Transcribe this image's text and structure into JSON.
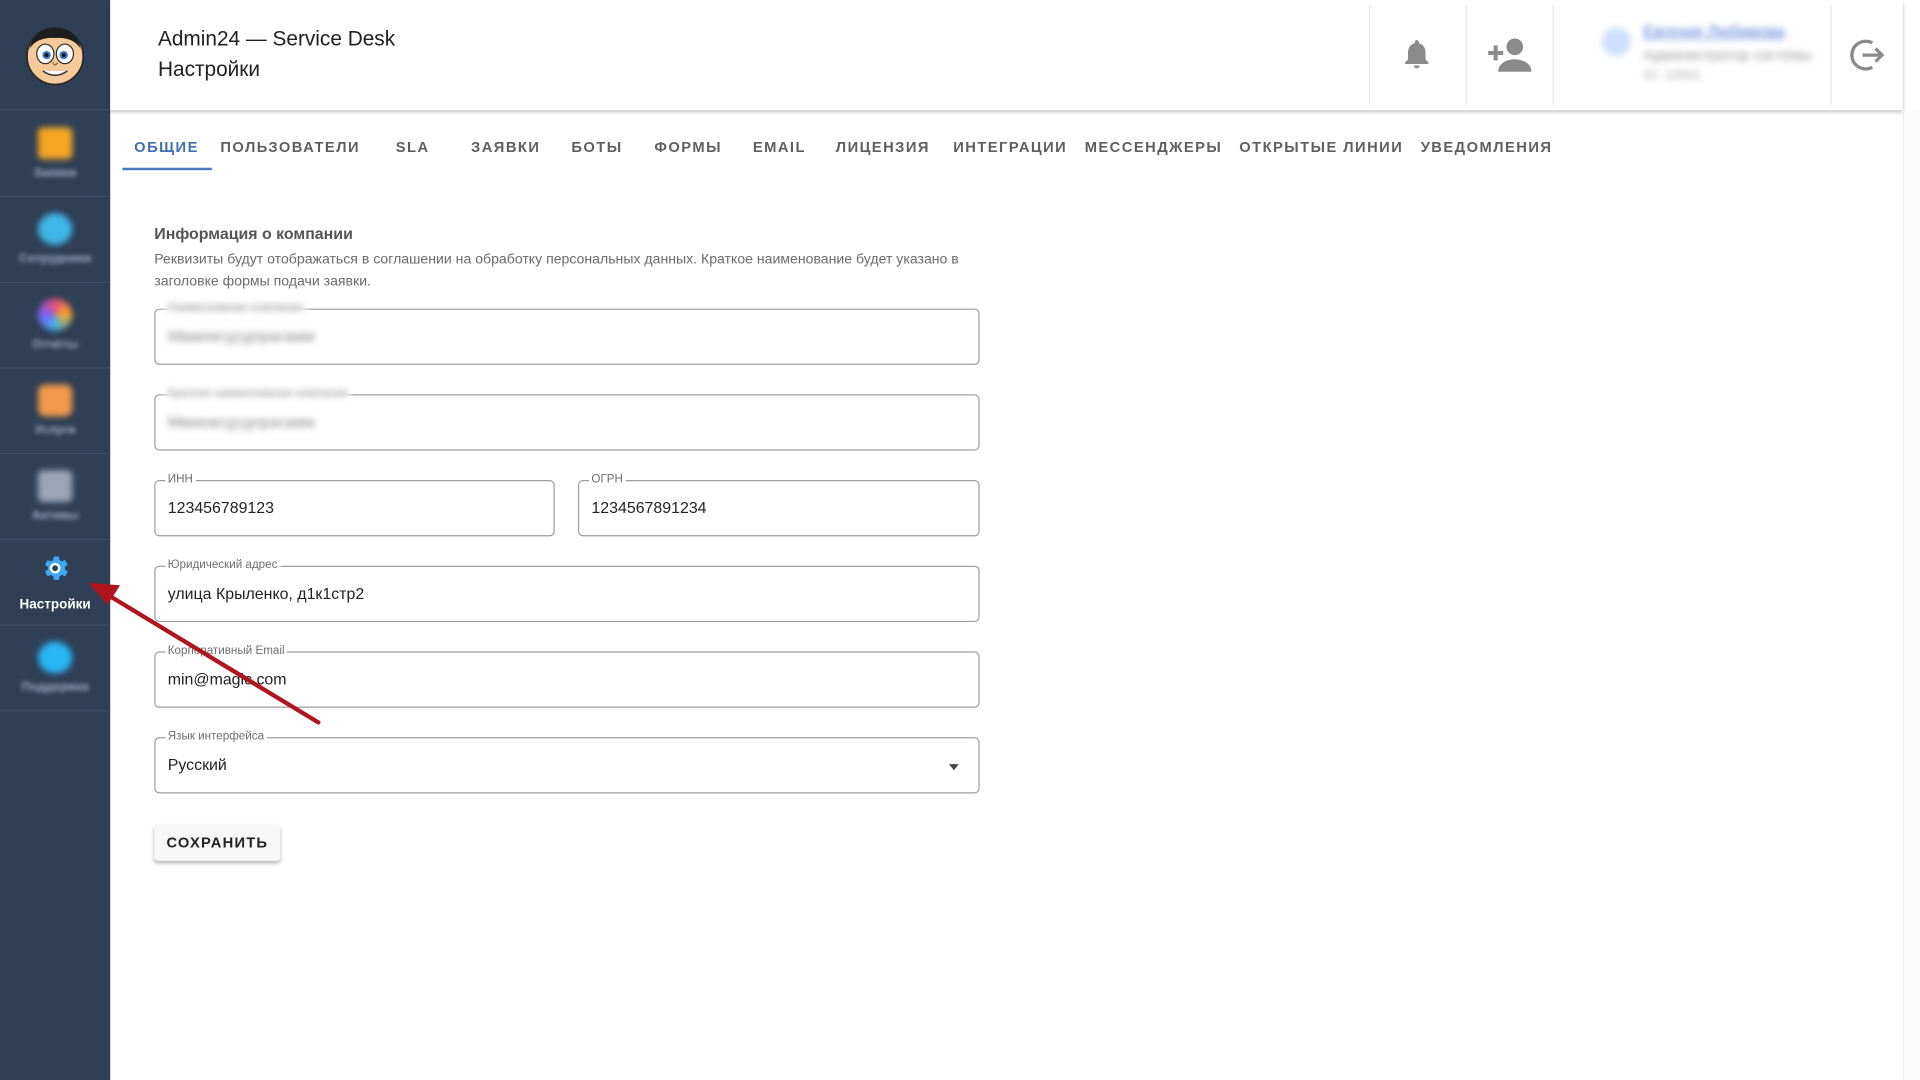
{
  "header": {
    "app_title": "Admin24 — Service Desk",
    "page_title": "Настройки",
    "user": {
      "name": "Евгения Любимова",
      "role": "Администратор системы",
      "id": "ID: 10001"
    }
  },
  "sidebar": {
    "items": [
      {
        "label": "Заявки",
        "icon": "folder-icon",
        "color": "#f5a623"
      },
      {
        "label": "Сотрудники",
        "icon": "users-icon",
        "color": "#3fb6e8"
      },
      {
        "label": "Отчёты",
        "icon": "chart-icon",
        "color": "#e94e77"
      },
      {
        "label": "Услуги",
        "icon": "catalog-icon",
        "color": "#f2994a"
      },
      {
        "label": "Активы",
        "icon": "asset-icon",
        "color": "#9aa6b8"
      },
      {
        "label": "Настройки",
        "icon": "gear-icon",
        "color": "#ffffff",
        "active": true
      },
      {
        "label": "Поддержка",
        "icon": "support-icon",
        "color": "#29b6f6"
      }
    ]
  },
  "tabs": [
    {
      "label": "ОБЩИЕ",
      "active": true
    },
    {
      "label": "ПОЛЬЗОВАТЕЛИ"
    },
    {
      "label": "SLA"
    },
    {
      "label": "ЗАЯВКИ"
    },
    {
      "label": "БОТЫ"
    },
    {
      "label": "ФОРМЫ"
    },
    {
      "label": "EMAIL"
    },
    {
      "label": "ЛИЦЕНЗИЯ"
    },
    {
      "label": "ИНТЕГРАЦИИ"
    },
    {
      "label": "МЕССЕНДЖЕРЫ"
    },
    {
      "label": "ОТКРЫТЫЕ ЛИНИИ"
    },
    {
      "label": "УВЕДОМЛЕНИЯ"
    }
  ],
  "form": {
    "section_title": "Информация о компании",
    "section_desc": "Реквизиты будут отображаться в соглашении на обработку персональных данных. Краткое наименование будет указано в заголовке формы подачи заявки.",
    "company_name": {
      "label": "Наименование компании",
      "value": "Мвмемтдтдпрагамм"
    },
    "short_name": {
      "label": "Краткое наименование компании",
      "value": "Мвмемтдтдпрагамм"
    },
    "inn": {
      "label": "ИНН",
      "value": "123456789123"
    },
    "ogrn": {
      "label": "ОГРН",
      "value": "1234567891234"
    },
    "address": {
      "label": "Юридический адрес",
      "value": "улица Крыленко, д1к1стр2"
    },
    "email": {
      "label": "Корпоративный Email",
      "value": "min@magic.com"
    },
    "language": {
      "label": "Язык интерфейса",
      "value": "Русский"
    },
    "save_label": "СОХРАНИТЬ"
  },
  "annotation": {
    "color": "#b0141c",
    "points_to": "Настройки"
  }
}
